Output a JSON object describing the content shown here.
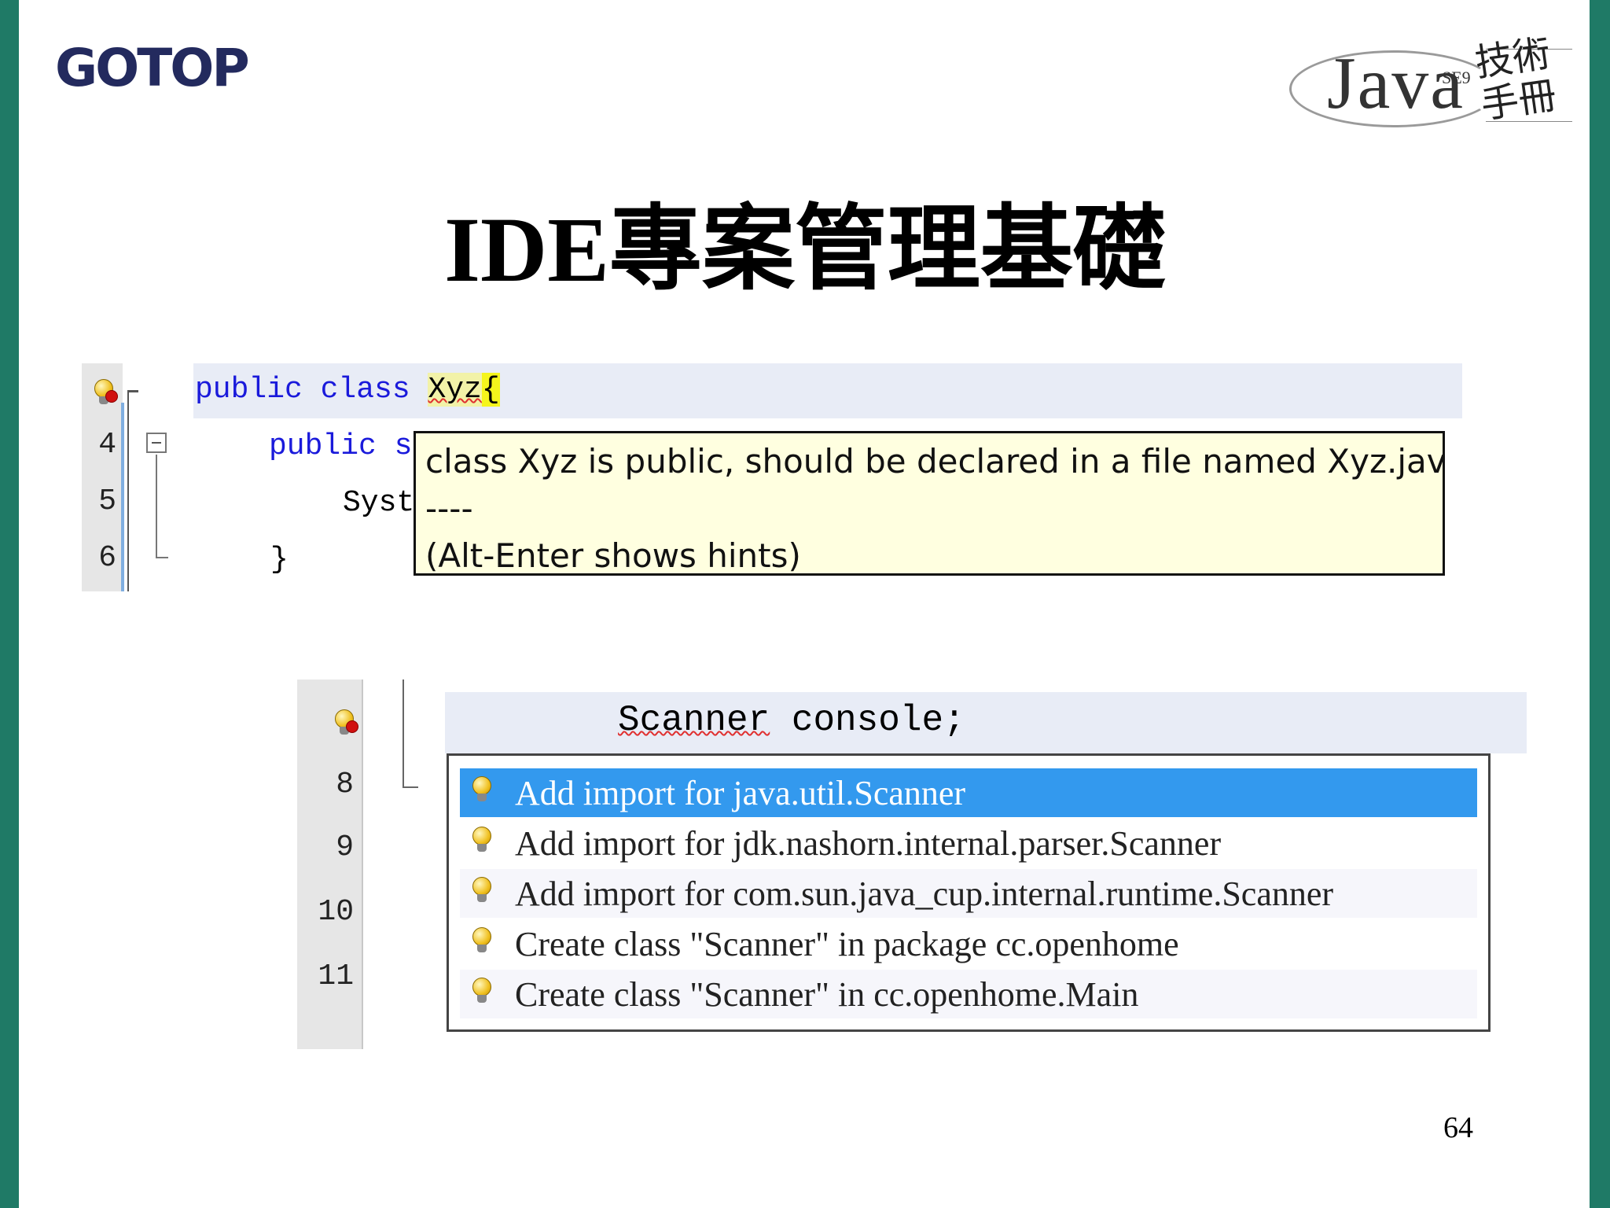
{
  "slide": {
    "logo_left": "GOTOP",
    "logo_right_text": "Java",
    "logo_right_sup": "SE9",
    "logo_right_cjk": "技術手冊",
    "title": "IDE專案管理基礎",
    "page_number": "64"
  },
  "panel1": {
    "line_numbers": [
      "4",
      "5",
      "6"
    ],
    "code": {
      "line1_prefix": "public class ",
      "line1_class": "Xyz",
      "line1_brace": "{",
      "line2": "public st",
      "line3": "Syst",
      "line4": "}"
    },
    "tooltip": {
      "line1": "class Xyz is public, should be declared in a file named Xyz.java",
      "line2": "----",
      "line3": "(Alt-Enter shows hints)"
    }
  },
  "panel2": {
    "line_numbers": [
      "8",
      "9",
      "10",
      "11"
    ],
    "code": {
      "type": "Scanner",
      "rest": " console;"
    },
    "hints": [
      {
        "label": "Add import for java.util.Scanner",
        "selected": true
      },
      {
        "label": "Add import for jdk.nashorn.internal.parser.Scanner",
        "selected": false
      },
      {
        "label": "Add import for com.sun.java_cup.internal.runtime.Scanner",
        "selected": false
      },
      {
        "label": "Create class \"Scanner\" in package cc.openhome",
        "selected": false
      },
      {
        "label": "Create class \"Scanner\" in cc.openhome.Main",
        "selected": false
      }
    ]
  },
  "colors": {
    "side_bar": "#1f7a66",
    "keyword": "#1a1adb",
    "tooltip_bg": "#ffffe0",
    "selection": "#3399ee",
    "current_line": "#e8ecf6"
  },
  "icons": [
    "hint-error-bulb-icon",
    "hint-bulb-icon",
    "fold-collapse-icon"
  ]
}
